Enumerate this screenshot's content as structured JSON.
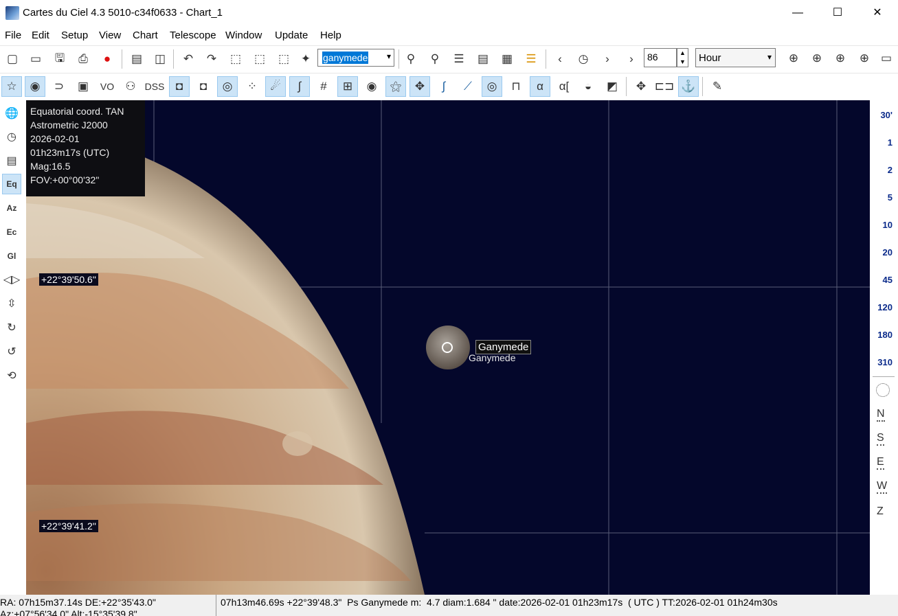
{
  "window": {
    "title": "Cartes du Ciel 4.3 5010-c34f0633 - Chart_1",
    "minimize": "—",
    "maximize": "☐",
    "close": "✕"
  },
  "menu": [
    "File",
    "Edit",
    "Setup",
    "View",
    "Chart",
    "Telescope",
    "Window",
    "Update",
    "Help"
  ],
  "toolbar": {
    "search_value": "ganymede",
    "step_value": "86",
    "step_unit": "Hour",
    "vo_label": "VO",
    "dss_label": "DSS",
    "alpha_label": "α",
    "alpha_bracket_label": "α["
  },
  "chart": {
    "info": [
      "Equatorial coord. TAN",
      "Astrometric J2000",
      "2026-02-01",
      "01h23m17s (UTC)",
      "Mag:16.5",
      "FOV:+00°00'32\""
    ],
    "dec_label_upper": "+22°39'50.6\"",
    "dec_label_lower": "+22°39'41.2\"",
    "object_label": "Ganymede",
    "tooltip": "Ganymede"
  },
  "fov_scale": [
    "30'",
    "1",
    "2",
    "5",
    "10",
    "20",
    "45",
    "120",
    "180",
    "310"
  ],
  "compass": [
    "N",
    "S",
    "E",
    "W",
    "Z"
  ],
  "status": {
    "left_line1": "RA: 07h15m37.14s DE:+22°35'43.0\"",
    "left_line2": "Az:+07°56'34.0\" Alt:-15°35'39.8\"",
    "main": "07h13m46.69s +22°39'48.3\"  Ps Ganymede m:  4.7 diam:1.684 \" date:2026-02-01 01h23m17s  ( UTC ) TT:2026-02-01 01h24m30s"
  },
  "colors": {
    "sky": "#04072b",
    "active_button": "#cce4f7",
    "selection": "#0078d7",
    "fov_scale_text": "#0a2a8a"
  }
}
